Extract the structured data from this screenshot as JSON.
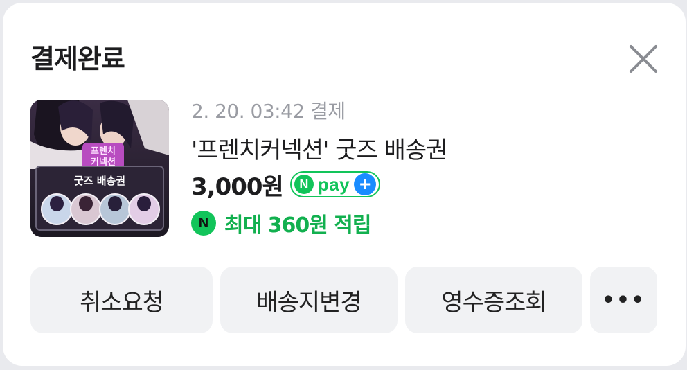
{
  "header": {
    "title": "결제완료",
    "close_icon": "close-icon"
  },
  "order": {
    "date": "2. 20. 03:42 결제",
    "product_name": "'프렌치커넥션' 굿즈 배송권",
    "price": "3,000원",
    "thumbnail": {
      "logo_text_line1": "프렌치",
      "logo_text_line2": "커넥션",
      "banner_text": "굿즈 배송권"
    }
  },
  "npay_badge": {
    "n": "N",
    "text": "pay",
    "plus": "+",
    "color": "#12c45a",
    "plus_color": "#1a8cff"
  },
  "points": {
    "icon_text": "N",
    "text": "최대 360원 적립",
    "color": "#12b04f"
  },
  "actions": {
    "cancel_label": "취소요청",
    "address_label": "배송지변경",
    "receipt_label": "영수증조회",
    "more_label": "•••"
  }
}
